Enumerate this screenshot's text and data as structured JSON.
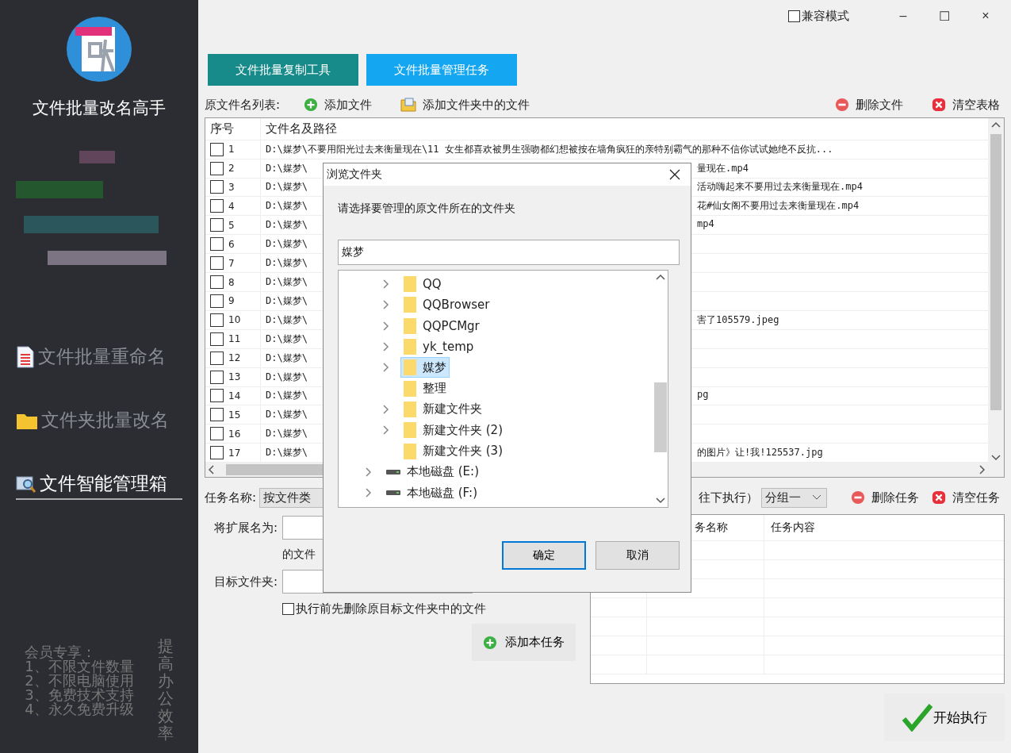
{
  "sidebar": {
    "app_name": "文件批量改名高手",
    "items": [
      {
        "label": "文件批量重命名",
        "kind": "doc",
        "selected": false
      },
      {
        "label": "文件夹批量改名",
        "kind": "folder",
        "selected": false
      },
      {
        "label": "文件智能管理箱",
        "kind": "search",
        "selected": true
      }
    ],
    "member_title": "会员专享：",
    "member_lines": [
      "1、不限文件数量",
      "2、不限电脑使用",
      "3、免费技术支持",
      "4、永久免费升级"
    ],
    "slogan": "提高办公效率"
  },
  "titlebar": {
    "compat": {
      "label": "兼容模式",
      "checked": false
    },
    "buttons": [
      "–",
      "☐",
      "×"
    ]
  },
  "tabs": [
    {
      "label": "文件批量复制工具",
      "selected": false
    },
    {
      "label": "文件批量管理任务",
      "selected": true
    }
  ],
  "toolbar": {
    "label": "原文件名列表:",
    "left": [
      {
        "label": "添加文件",
        "kind": "add"
      },
      {
        "label": "添加文件夹中的文件",
        "kind": "folder"
      }
    ],
    "right": [
      {
        "label": "删除文件",
        "kind": "remove"
      },
      {
        "label": "清空表格",
        "kind": "clear"
      }
    ]
  },
  "table": {
    "columns": [
      "序号",
      "文件名及路径"
    ],
    "rows": [
      {
        "no": "1",
        "checked": false,
        "path": "D:\\媒梦\\不要用阳光过去来衡量现在\\11 女生都喜欢被男生强吻都幻想被按在墙角疯狂的亲特别霸气的那种不信你试试她绝不反抗..."
      },
      {
        "no": "2",
        "checked": false,
        "path": "D:\\媒梦\\",
        "path_end": "量现在.mp4"
      },
      {
        "no": "3",
        "checked": false,
        "path": "D:\\媒梦\\",
        "path_end": "活动嗨起来不要用过去来衡量现在.mp4"
      },
      {
        "no": "4",
        "checked": false,
        "path": "D:\\媒梦\\",
        "path_end": "花#仙女阁不要用过去来衡量现在.mp4"
      },
      {
        "no": "5",
        "checked": false,
        "path": "D:\\媒梦\\",
        "path_end": "mp4"
      },
      {
        "no": "6",
        "checked": false,
        "path": "D:\\媒梦\\"
      },
      {
        "no": "7",
        "checked": false,
        "path": "D:\\媒梦\\"
      },
      {
        "no": "8",
        "checked": false,
        "path": "D:\\媒梦\\"
      },
      {
        "no": "9",
        "checked": false,
        "path": "D:\\媒梦\\"
      },
      {
        "no": "10",
        "checked": false,
        "path": "D:\\媒梦\\",
        "path_end": "害了105579.jpeg"
      },
      {
        "no": "11",
        "checked": false,
        "path": "D:\\媒梦\\"
      },
      {
        "no": "12",
        "checked": false,
        "path": "D:\\媒梦\\"
      },
      {
        "no": "13",
        "checked": false,
        "path": "D:\\媒梦\\"
      },
      {
        "no": "14",
        "checked": false,
        "path": "D:\\媒梦\\",
        "path_end": "pg"
      },
      {
        "no": "15",
        "checked": false,
        "path": "D:\\媒梦\\"
      },
      {
        "no": "16",
        "checked": false,
        "path": "D:\\媒梦\\"
      },
      {
        "no": "17",
        "checked": false,
        "path": "D:\\媒梦\\",
        "path_end": "的图片》让!我!125537.jpg"
      }
    ]
  },
  "task_form": {
    "name_label": "任务名称:",
    "name_value": "按文件类",
    "ext_label": "将扩展名为:",
    "ext_suffix": "的文件",
    "target_label": "目标文件夹:",
    "delete_first": {
      "label": "执行前先删除原目标文件夹中的文件",
      "checked": false
    },
    "add_button": "添加本任务"
  },
  "task_bar": {
    "order_text": "往下执行）",
    "group": "分组一",
    "buttons": [
      {
        "label": "删除任务",
        "kind": "remove"
      },
      {
        "label": "清空任务",
        "kind": "clear"
      }
    ]
  },
  "task_table": {
    "columns": [
      "务名称",
      "任务内容"
    ]
  },
  "start_button": "开始执行",
  "dialog": {
    "title": "浏览文件夹",
    "prompt": "请选择要管理的原文件所在的文件夹",
    "field": "媒梦",
    "tree": [
      {
        "children": [
          {
            "label": "QQ",
            "kind": "folder",
            "expandable": true,
            "selected": false
          },
          {
            "label": "QQBrowser",
            "kind": "folder",
            "expandable": true,
            "selected": false
          },
          {
            "label": "QQPCMgr",
            "kind": "folder",
            "expandable": true,
            "selected": false
          },
          {
            "label": "yk_temp",
            "kind": "folder",
            "expandable": true,
            "selected": false
          },
          {
            "label": "媒梦",
            "kind": "folder",
            "expandable": true,
            "selected": true
          },
          {
            "label": "整理",
            "kind": "folder",
            "expandable": false,
            "selected": false
          },
          {
            "label": "新建文件夹",
            "kind": "folder",
            "expandable": true,
            "selected": false
          },
          {
            "label": "新建文件夹 (2)",
            "kind": "folder",
            "expandable": true,
            "selected": false
          },
          {
            "label": "新建文件夹 (3)",
            "kind": "folder",
            "expandable": false,
            "selected": false
          }
        ]
      },
      {
        "label": "本地磁盘 (E:)",
        "kind": "drive",
        "expandable": true,
        "selected": false
      },
      {
        "label": "本地磁盘 (F:)",
        "kind": "drive",
        "expandable": true,
        "selected": false
      }
    ],
    "buttons": [
      {
        "label": "确定",
        "kind": "primary"
      },
      {
        "label": "取消",
        "kind": "normal"
      }
    ]
  }
}
